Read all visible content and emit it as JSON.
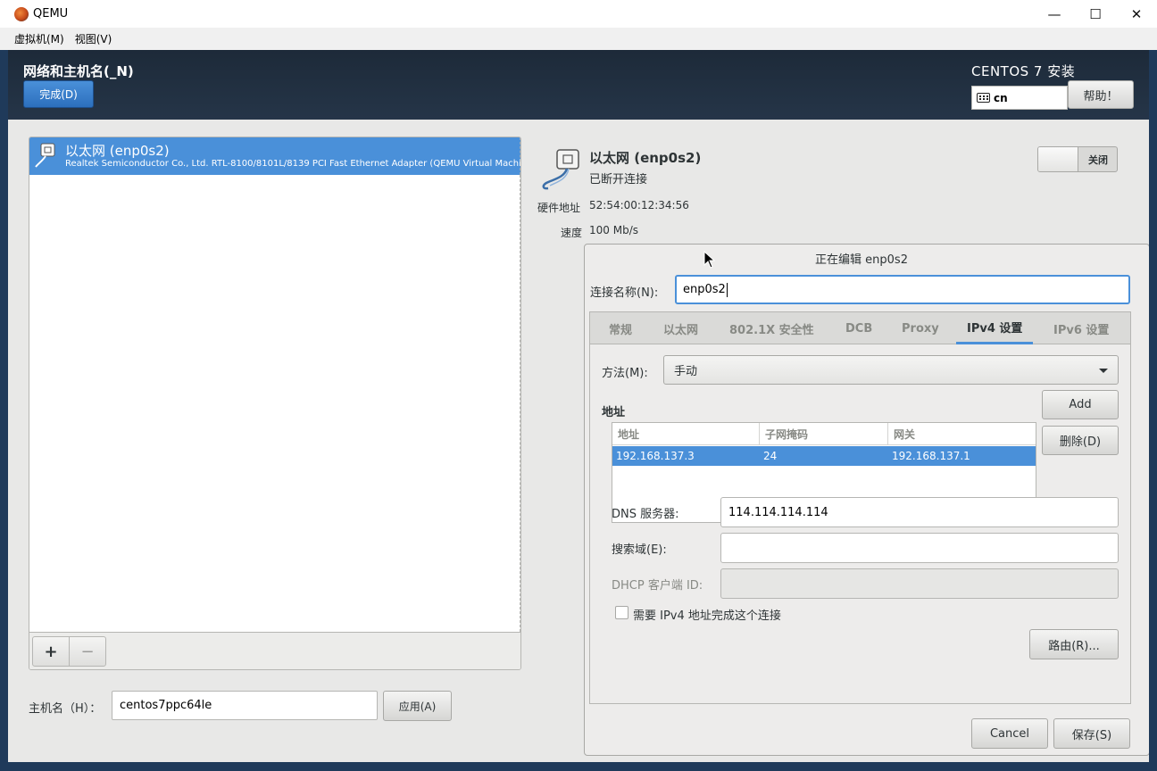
{
  "window": {
    "title": "QEMU",
    "menu": [
      "虚拟机(M)",
      "视图(V)"
    ]
  },
  "header": {
    "title": "网络和主机名(_N)",
    "done_label": "完成(D)",
    "product": "CENTOS 7 安装",
    "keyboard_layout": "cn",
    "help_label": "帮助！"
  },
  "device_list": {
    "items": [
      {
        "name": "以太网 (enp0s2)",
        "description": "Realtek Semiconductor Co., Ltd. RTL-8100/8101L/8139 PCI Fast Ethernet Adapter (QEMU Virtual Machine)",
        "selected": true
      }
    ],
    "add_label": "+",
    "remove_label": "−"
  },
  "hostname": {
    "label": "主机名（H）：",
    "value": "centos7ppc64le",
    "apply_label": "应用(A)"
  },
  "device_detail": {
    "name": "以太网 (enp0s2)",
    "status": "已断开连接",
    "toggle_label": "关闭",
    "hw_label": "硬件地址",
    "hw_value": "52:54:00:12:34:56",
    "speed_label": "速度",
    "speed_value": "100 Mb/s"
  },
  "editor": {
    "title": "正在编辑 enp0s2",
    "conn_name_label": "连接名称(N):",
    "conn_name_value": "enp0s2",
    "tabs": [
      "常规",
      "以太网",
      "802.1X 安全性",
      "DCB",
      "Proxy",
      "IPv4 设置",
      "IPv6 设置"
    ],
    "active_tab": "IPv4 设置",
    "method_label": "方法(M):",
    "method_value": "手动",
    "addresses_heading": "地址",
    "columns": [
      "地址",
      "子网掩码",
      "网关"
    ],
    "rows": [
      [
        "192.168.137.3",
        "24",
        "192.168.137.1"
      ]
    ],
    "add_label": "Add",
    "delete_label": "删除(D)",
    "dns_label": "DNS 服务器:",
    "dns_value": "114.114.114.114",
    "search_label": "搜索域(E):",
    "search_value": "",
    "dhcp_label": "DHCP 客户端 ID:",
    "dhcp_value": "",
    "require_ipv4_label": "需要 IPv4 地址完成这个连接",
    "require_ipv4_checked": false,
    "routes_label": "路由(R)...",
    "cancel_label": "Cancel",
    "save_label": "保存(S)"
  },
  "colors": {
    "accent": "#4a90d9",
    "header_bg": "#1d2a39",
    "panel_bg": "#e8e8e7"
  }
}
